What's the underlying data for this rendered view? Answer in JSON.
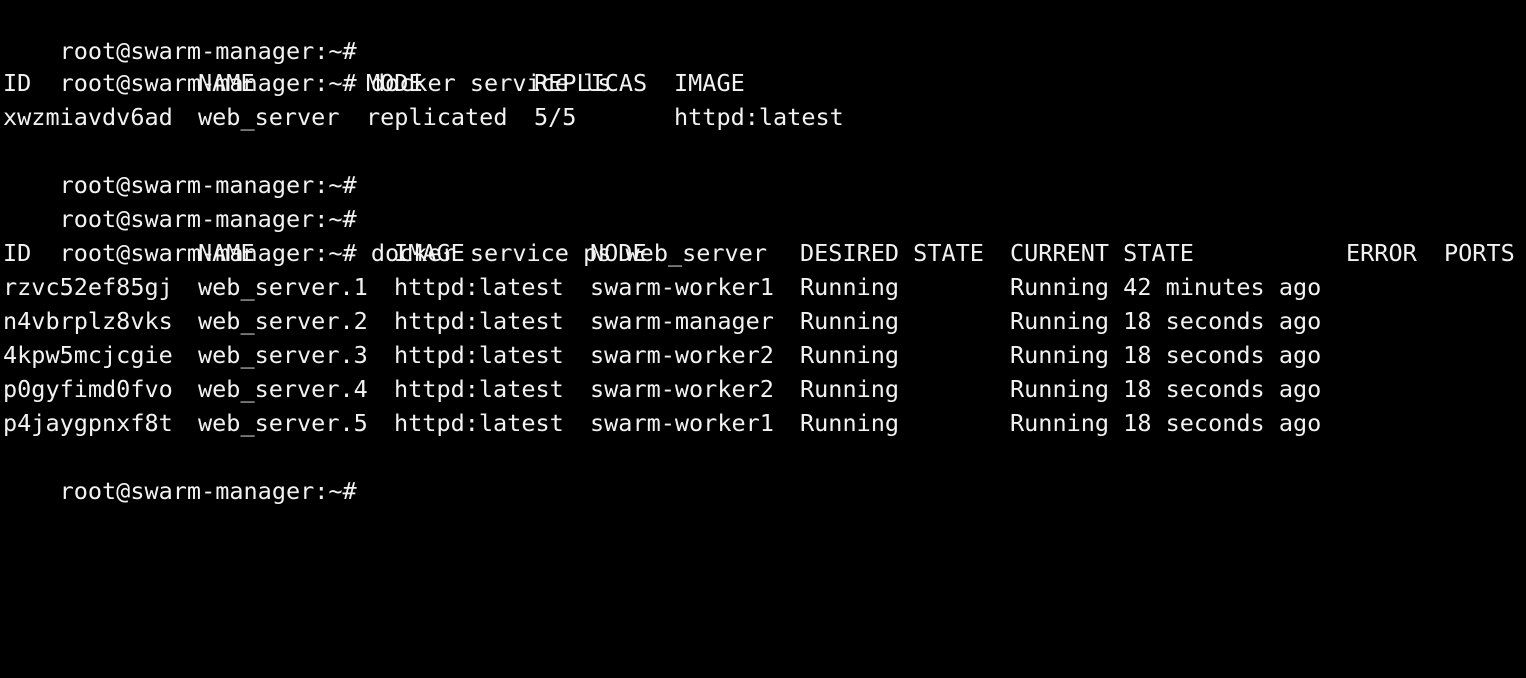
{
  "terminal": {
    "background": "#000000",
    "foreground": "#f2f2f2",
    "lines": {
      "l0": "root@swarm-manager:~#",
      "l1": "root@swarm-manager:~# docker service ls",
      "l4": "root@swarm-manager:~#",
      "l5": "root@swarm-manager:~#",
      "l6": "root@swarm-manager:~# docker service ps web_server",
      "l13": "root@swarm-manager:~#"
    },
    "service_ls": {
      "headers": {
        "id": "ID",
        "name": "NAME",
        "mode": "MODE",
        "replicas": "REPLICAS",
        "image": "IMAGE"
      },
      "rows": [
        {
          "id": "xwzmiavdv6ad",
          "name": "web_server",
          "mode": "replicated",
          "replicas": "5/5",
          "image": "httpd:latest"
        }
      ]
    },
    "service_ps": {
      "headers": {
        "id": "ID",
        "name": "NAME",
        "image": "IMAGE",
        "node": "NODE",
        "desired": "DESIRED STATE",
        "current": "CURRENT STATE",
        "error": "ERROR",
        "ports": "PORTS"
      },
      "rows": [
        {
          "id": "rzvc52ef85gj",
          "name": "web_server.1",
          "image": "httpd:latest",
          "node": "swarm-worker1",
          "desired": "Running",
          "current": "Running 42 minutes ago"
        },
        {
          "id": "n4vbrplz8vks",
          "name": "web_server.2",
          "image": "httpd:latest",
          "node": "swarm-manager",
          "desired": "Running",
          "current": "Running 18 seconds ago"
        },
        {
          "id": "4kpw5mcjcgie",
          "name": "web_server.3",
          "image": "httpd:latest",
          "node": "swarm-worker2",
          "desired": "Running",
          "current": "Running 18 seconds ago"
        },
        {
          "id": "p0gyfimd0fvo",
          "name": "web_server.4",
          "image": "httpd:latest",
          "node": "swarm-worker2",
          "desired": "Running",
          "current": "Running 18 seconds ago"
        },
        {
          "id": "p4jaygpnxf8t",
          "name": "web_server.5",
          "image": "httpd:latest",
          "node": "swarm-worker1",
          "desired": "Running",
          "current": "Running 18 seconds ago"
        }
      ]
    }
  }
}
